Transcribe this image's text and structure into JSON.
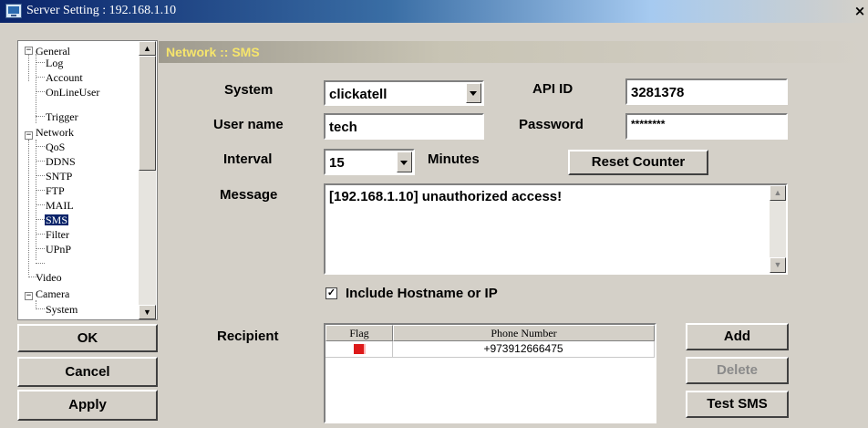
{
  "window": {
    "title": "Server Setting : 192.168.1.10",
    "close_glyph": "×"
  },
  "tree": {
    "nodes": [
      {
        "label": "General",
        "expander": "−"
      },
      {
        "label": "Log"
      },
      {
        "label": "Account"
      },
      {
        "label": "OnLineUser"
      },
      {
        "label": "Trigger"
      },
      {
        "label": "Network",
        "expander": "−"
      },
      {
        "label": "QoS"
      },
      {
        "label": "DDNS"
      },
      {
        "label": "SNTP"
      },
      {
        "label": "FTP"
      },
      {
        "label": "MAIL"
      },
      {
        "label": "SMS",
        "selected": true
      },
      {
        "label": "Filter"
      },
      {
        "label": "UPnP"
      },
      {
        "label": "Video"
      },
      {
        "label": "Camera",
        "expander": "−"
      },
      {
        "label": "System"
      }
    ],
    "scroll_up_glyph": "▲",
    "scroll_down_glyph": "▼"
  },
  "buttons": {
    "ok": "OK",
    "cancel": "Cancel",
    "apply": "Apply"
  },
  "section": {
    "title": "Network :: SMS"
  },
  "form": {
    "system_label": "System",
    "system_value": "clickatell",
    "api_id_label": "API ID",
    "api_id_value": "3281378",
    "username_label": "User name",
    "username_value": "tech",
    "password_label": "Password",
    "password_value": "********",
    "interval_label": "Interval",
    "interval_value": "15",
    "minutes_label": "Minutes",
    "reset_counter": "Reset Counter",
    "message_label": "Message",
    "message_value": "[192.168.1.10] unauthorized access!",
    "include_hostname_label": "Include Hostname or IP",
    "include_hostname_checked": true,
    "check_glyph": "✓",
    "recipient_label": "Recipient"
  },
  "recipients": {
    "columns": [
      "Flag",
      "Phone Number"
    ],
    "rows": [
      {
        "phone": "+973912666475"
      }
    ]
  },
  "recipient_buttons": {
    "add": "Add",
    "delete": "Delete",
    "test_sms": "Test SMS"
  },
  "colors": {
    "section_title": "#f6e56c",
    "flag": "#dd1a1a",
    "selection": "#0a246a"
  }
}
